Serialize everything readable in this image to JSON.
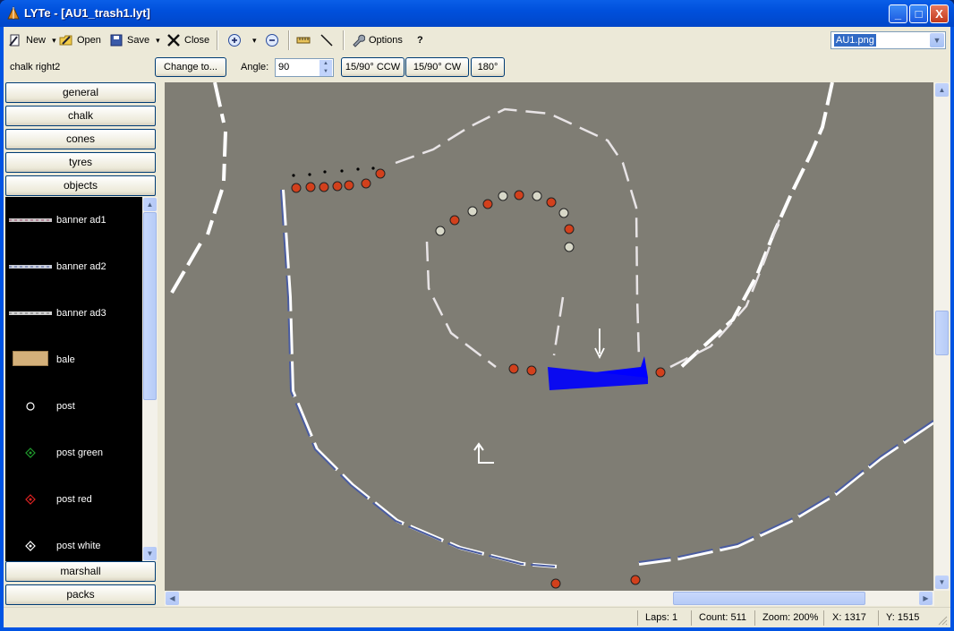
{
  "window": {
    "title": "LYTe - [AU1_trash1.lyt]",
    "minimize": "_",
    "maximize": "□",
    "close": "X"
  },
  "toolbar": {
    "new_label": "New",
    "open_label": "Open",
    "save_label": "Save",
    "close_label": "Close",
    "options_label": "Options",
    "help_label": "?",
    "dropdown_arrow": "▾",
    "zoom_in_icon": "zoom-in-icon",
    "zoom_out_icon": "zoom-out-icon",
    "texture_select_value": "AU1.png"
  },
  "object_bar": {
    "selected_object": "chalk right2",
    "change_to_label": "Change to...",
    "angle_label": "Angle:",
    "angle_value": "90",
    "rotate_ccw_label": "15/90° CCW",
    "rotate_cw_label": "15/90° CW",
    "rotate_180_label": "180°"
  },
  "categories": {
    "general": "general",
    "chalk": "chalk",
    "cones": "cones",
    "tyres": "tyres",
    "objects": "objects",
    "marshall": "marshall",
    "packs": "packs"
  },
  "objects": [
    {
      "label": "banner ad1",
      "icon": "banner-red"
    },
    {
      "label": "banner ad2",
      "icon": "banner-blue"
    },
    {
      "label": "banner ad3",
      "icon": "banner-grey"
    },
    {
      "label": "bale",
      "icon": "bale"
    },
    {
      "label": "post",
      "icon": "post-white-circle"
    },
    {
      "label": "post green",
      "icon": "post-green"
    },
    {
      "label": "post red",
      "icon": "post-red"
    },
    {
      "label": "post white",
      "icon": "post-white"
    }
  ],
  "status": {
    "laps": "Laps: 1",
    "count": "Count: 511",
    "zoom": "Zoom: 200%",
    "x": "X: 1317",
    "y": "Y: 1515"
  },
  "colors": {
    "track": "#7f7d74",
    "start_line": "#0000ff",
    "tyre_red": "#d2401c",
    "window_blue": "#0054e3"
  }
}
